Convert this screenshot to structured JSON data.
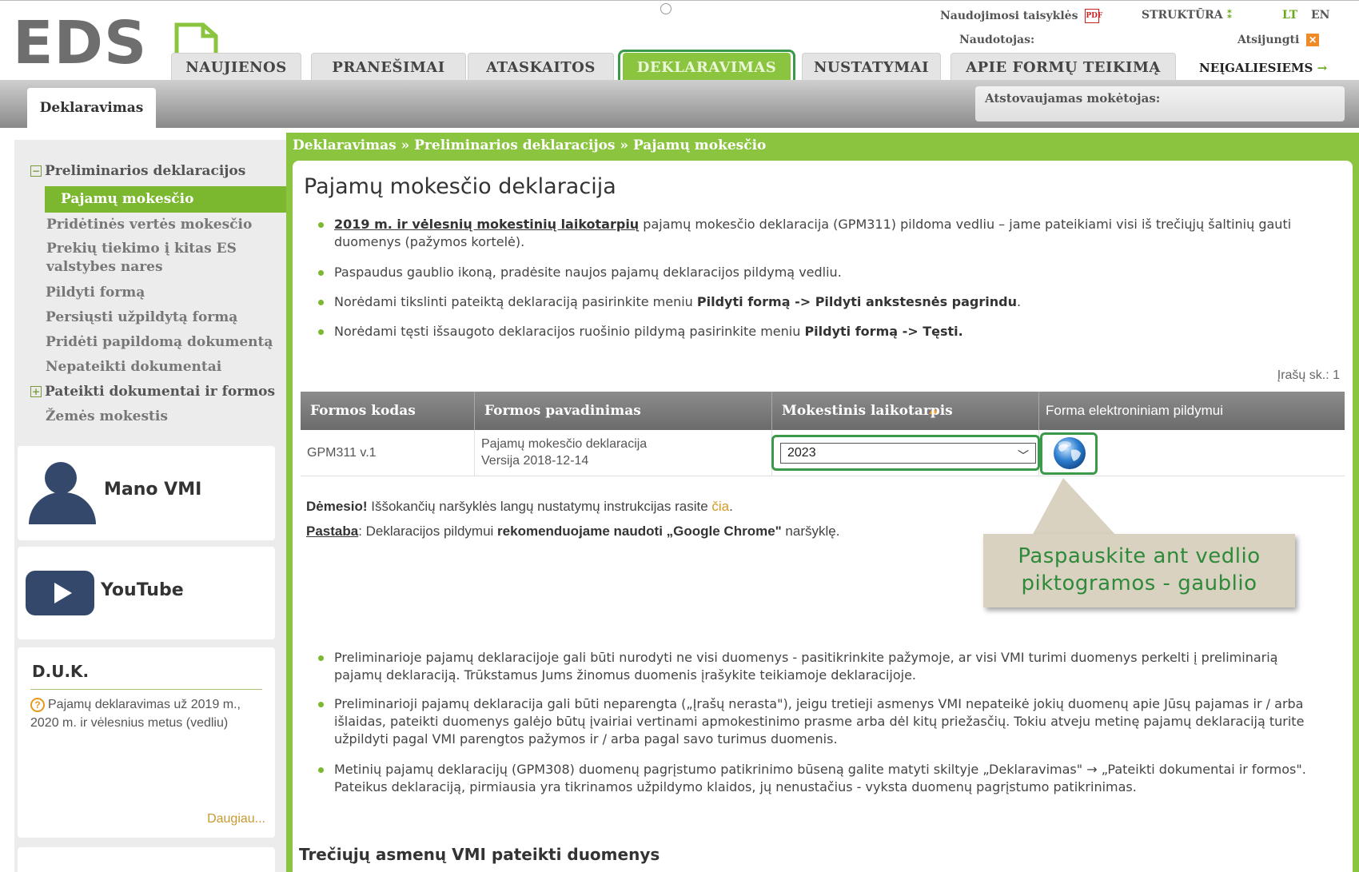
{
  "header": {
    "logo": "EDS",
    "terms_link": "Naudojimosi taisyklės",
    "structure_link": "STRUKTŪRA",
    "lang_lt": "LT",
    "lang_en": "EN",
    "user_label": "Naudotojas:",
    "logout": "Atsijungti",
    "payer_label": "Atstovaujamas mokėtojas:"
  },
  "nav": {
    "tabs": [
      {
        "label": "NAUJIENOS"
      },
      {
        "label": "PRANEŠIMAI"
      },
      {
        "label": "ATASKAITOS"
      },
      {
        "label": "DEKLARAVIMAS"
      },
      {
        "label": "NUSTATYMAI"
      },
      {
        "label": "APIE FORMŲ TEIKIMĄ"
      }
    ],
    "accessibility": "NEĮGALIESIEMS"
  },
  "subnav": {
    "tab": "Deklaravimas"
  },
  "sidebar": {
    "group1": "Preliminarios deklaracijos",
    "active": "Pajamų mokesčio",
    "pvm": "Pridėtinės vertės mokesčio",
    "es1": "Prekių tiekimo į kitas ES",
    "es2": "valstybes nares",
    "fill": "Pildyti formą",
    "send": "Persiųsti užpildytą formą",
    "add": "Pridėti papildomą dokumentą",
    "unsent": "Nepateikti dokumentai",
    "group2": "Pateikti dokumentai ir formos",
    "land": "Žemės mokestis"
  },
  "widgets": {
    "mano_vmi": "Mano VMI",
    "youtube": "YouTube",
    "duk_title": "D.U.K.",
    "duk_text": "Pajamų deklaravimas už 2019 m., 2020 m. ir vėlesnius metus (vedliu)",
    "duk_more": "Daugiau..."
  },
  "breadcrumb": {
    "part1": "Deklaravimas",
    "part2": "Preliminarios deklaracijos",
    "part3": "Pajamų mokesčio"
  },
  "main": {
    "title": "Pajamų mokesčio deklaracija",
    "b1_link": "2019 m. ir vėlesnių mokestinių laikotarpių",
    "b1_text": " pajamų mokesčio deklaracija (GPM311) pildoma vedliu – jame pateikiami visi iš trečiųjų šaltinių gauti duomenys (pažymos kortelė).",
    "b2": "Paspaudus gaublio ikoną, pradėsite naujos pajamų deklaracijos pildymą vedliu.",
    "b3_pre": "Norėdami tikslinti pateiktą deklaraciją pasirinkite meniu ",
    "b3_bold": "Pildyti formą -> Pildyti ankstesnės pagrindu",
    "b3_post": ".",
    "b4_pre": "Norėdami tęsti išsaugoto deklaracijos ruošinio pildymą pasirinkite meniu ",
    "b4_bold": "Pildyti formą -> Tęsti.",
    "records": "Įrašų sk.: 1"
  },
  "table": {
    "headers": {
      "code": "Formos kodas",
      "name": "Formos pavadinimas",
      "period": "Mokestinis laikotarpis",
      "form": "Forma elektroniniam pildymui"
    },
    "row": {
      "code": "GPM311 v.1",
      "name_line1": "Pajamų mokesčio deklaracija",
      "name_line2": "Versija 2018-12-14",
      "period": "2023"
    }
  },
  "notices": {
    "attention_bold": "Dėmesio!",
    "attention_text": " Iššokančių naršyklės langų nustatymų instrukcijas rasite ",
    "attention_link": "čia",
    "attention_end": ".",
    "note_label": "Pastaba",
    "note_text": ": Deklaracijos pildymui ",
    "note_bold": "rekomenduojame naudoti „Google Chrome\"",
    "note_end": " naršyklę."
  },
  "callout": {
    "line1": "Paspauskite ant vedlio",
    "line2": "piktogramos - gaublio"
  },
  "lower": {
    "b1": "Preliminarioje pajamų deklaracijoje gali būti nurodyti ne visi duomenys - pasitikrinkite pažymoje, ar visi VMI turimi duomenys perkelti į preliminarią pajamų deklaraciją. Trūkstamus Jums žinomus duomenis įrašykite teikiamoje deklaracijoje.",
    "b2": "Preliminarioji pajamų deklaracija gali būti neparengta („Įrašų nerasta\"), jeigu tretieji asmenys VMI nepateikė jokių duomenų apie Jūsų pajamas ir / arba išlaidas, pateikti duomenys galėjo būtų įvairiai vertinami apmokestinimo prasme arba dėl kitų priežasčių. Tokiu atveju metinę pajamų deklaraciją turite užpildyti pagal VMI parengtos pažymos ir / arba pagal savo turimus duomenis.",
    "b3": "Metinių pajamų deklaracijų (GPM308) duomenų pagrįstumo patikrinimo būseną galite matyti skiltyje „Deklaravimas\" → „Pateikti dokumentai ir formos\". Pateikus deklaraciją, pirmiausia yra tikrinamos užpildymo klaidos, jų nenustačius - vyksta duomenų pagrįstumo patikrinimas.",
    "section_title": "Trečiųjų asmenų VMI pateikti duomenys"
  }
}
